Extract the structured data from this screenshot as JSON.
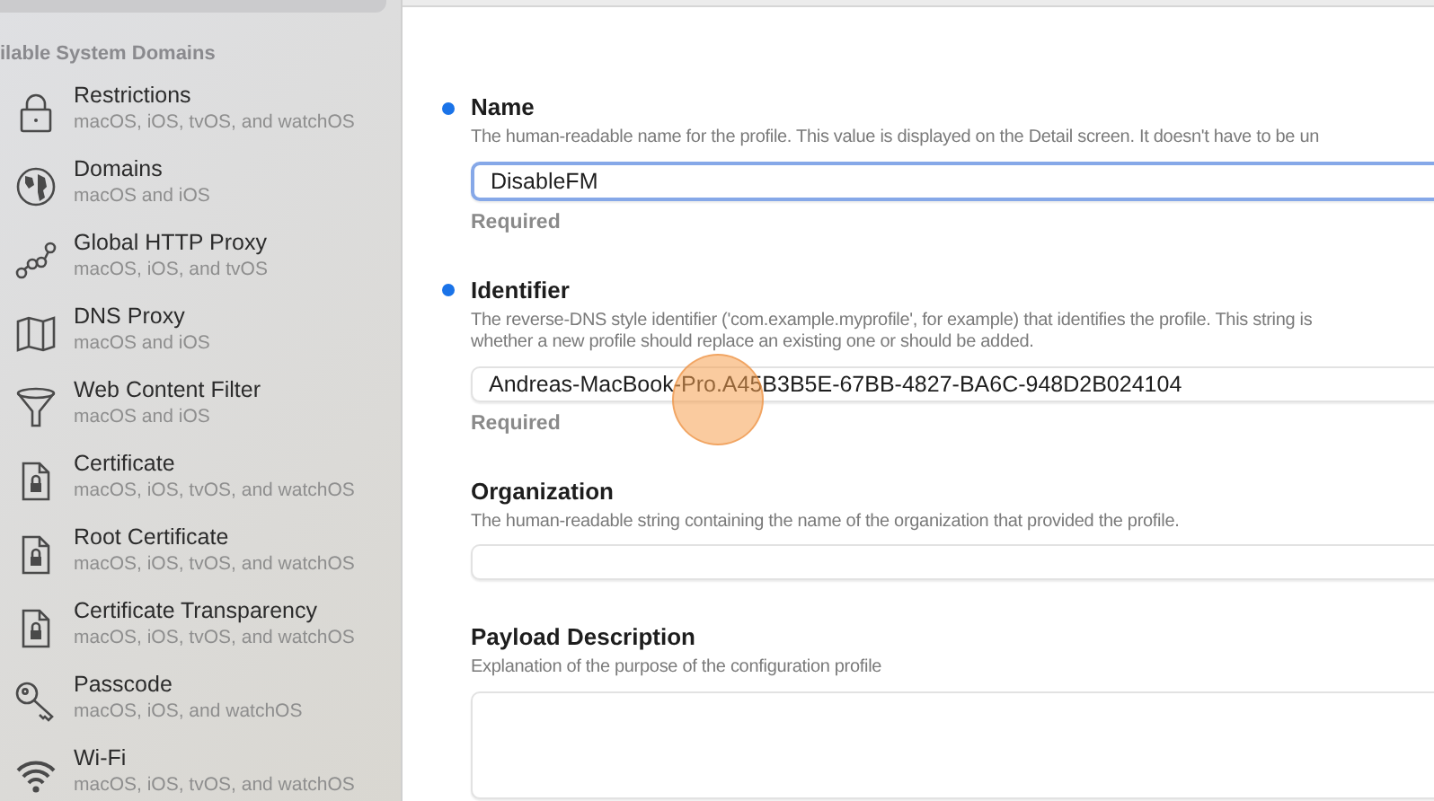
{
  "sidebar": {
    "section_title": "ilable System Domains",
    "items": [
      {
        "kind": "lock",
        "title": "Restrictions",
        "platforms": "macOS, iOS, tvOS, and watchOS"
      },
      {
        "kind": "globe",
        "title": "Domains",
        "platforms": "macOS and iOS"
      },
      {
        "kind": "nodes",
        "title": "Global HTTP Proxy",
        "platforms": "macOS, iOS, and tvOS"
      },
      {
        "kind": "map",
        "title": "DNS Proxy",
        "platforms": "macOS and iOS"
      },
      {
        "kind": "funnel",
        "title": "Web Content Filter",
        "platforms": "macOS and iOS"
      },
      {
        "kind": "doclock",
        "title": "Certificate",
        "platforms": "macOS, iOS, tvOS, and watchOS"
      },
      {
        "kind": "doclock",
        "title": "Root Certificate",
        "platforms": "macOS, iOS, tvOS, and watchOS"
      },
      {
        "kind": "doclock",
        "title": "Certificate Transparency",
        "platforms": "macOS, iOS, tvOS, and watchOS"
      },
      {
        "kind": "key",
        "title": "Passcode",
        "platforms": "macOS, iOS, and watchOS"
      },
      {
        "kind": "wifi",
        "title": "Wi-Fi",
        "platforms": "macOS, iOS, tvOS, and watchOS"
      }
    ]
  },
  "fields": [
    {
      "label": "Name",
      "required": true,
      "focused": true,
      "kind": "line",
      "description": "The human-readable name for the profile. This value is displayed on the Detail screen. It doesn't have to be un",
      "value": "DisableFM",
      "note": "Required"
    },
    {
      "label": "Identifier",
      "required": true,
      "focused": false,
      "kind": "line",
      "description": "The reverse-DNS style identifier ('com.example.myprofile', for example) that identifies the profile. This string is\nwhether a new profile should replace an existing one or should be added.",
      "value": "Andreas-MacBook-Pro.A45B3B5E-67BB-4827-BA6C-948D2B024104",
      "note": "Required"
    },
    {
      "label": "Organization",
      "required": false,
      "focused": false,
      "kind": "line",
      "description": "The human-readable string containing the name of the organization that provided the profile."
    },
    {
      "label": "Payload Description",
      "required": false,
      "focused": false,
      "kind": "area",
      "description": "Explanation of the purpose of the configuration profile"
    }
  ]
}
